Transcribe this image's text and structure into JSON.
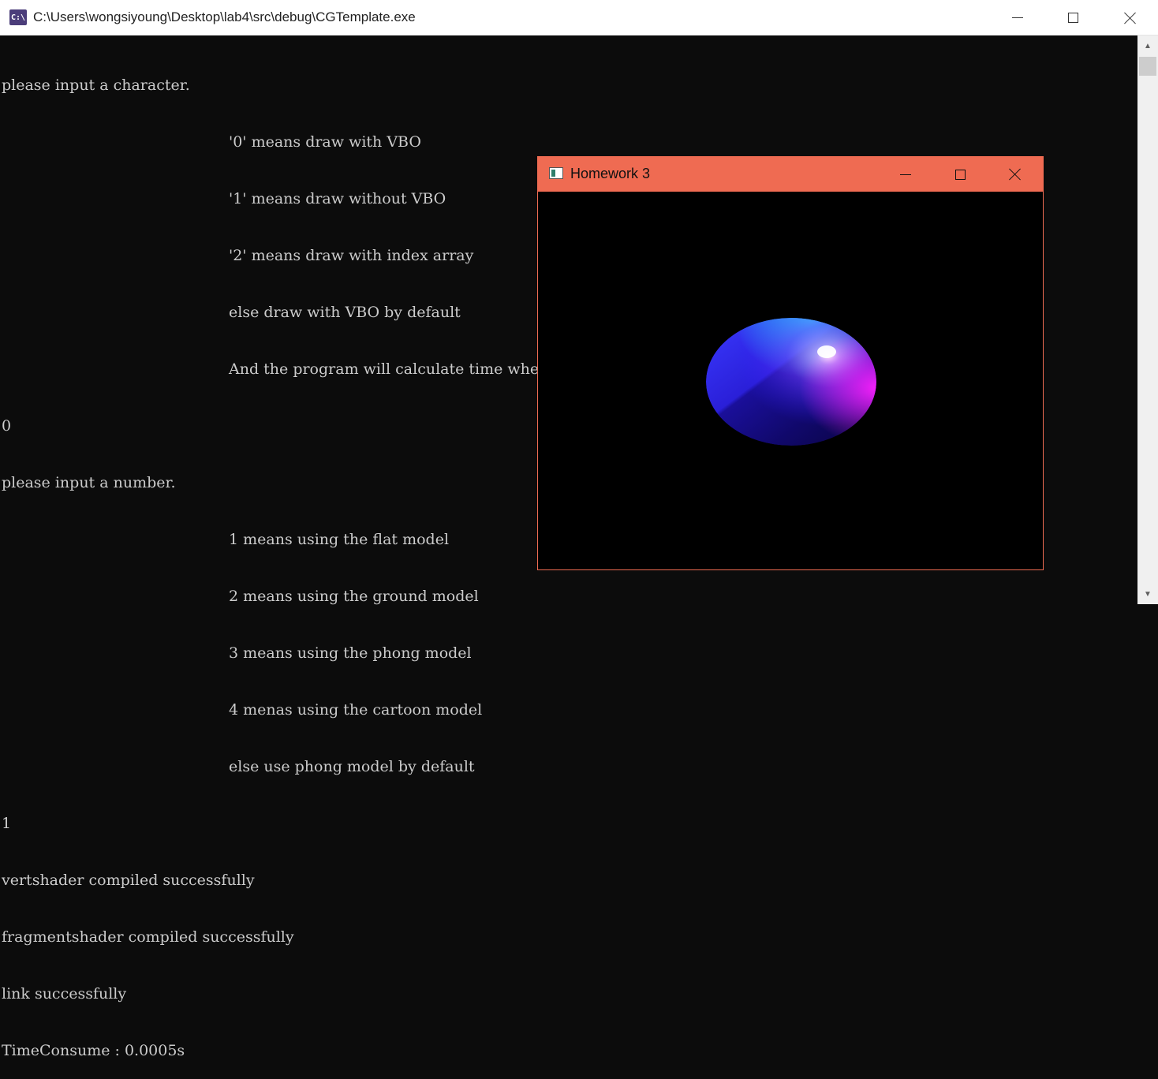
{
  "console": {
    "icon_label": "C:\\",
    "title": "C:\\Users\\wongsiyoung\\Desktop\\lab4\\src\\debug\\CGTemplate.exe",
    "lines": [
      "please input a character.",
      "'0' means draw with VBO",
      "'1' means draw without VBO",
      "'2' means draw with index array",
      "else draw with VBO by default",
      "And the program will calculate time when painting for the first time",
      "0",
      "please input a number.",
      "1 means using the flat model",
      "2 means using the ground model",
      "3 means using the phong model",
      "4 menas using the cartoon model",
      "else use phong model by default",
      "1",
      "vertshader compiled successfully",
      "fragmentshader compiled successfully",
      "link successfully",
      "TimeConsume : 0.0005s"
    ]
  },
  "gl_window": {
    "title": "Homework 3",
    "accent_color": "#ef6b52"
  },
  "colors": {
    "console_bg": "#0c0c0c",
    "console_text": "#cccccc"
  }
}
